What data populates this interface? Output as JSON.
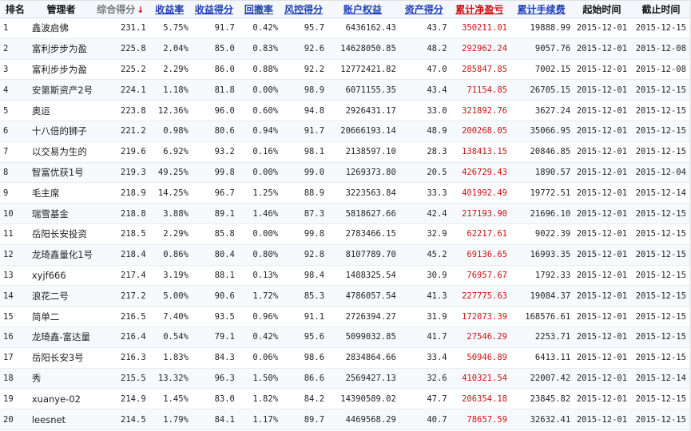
{
  "headers": {
    "rank": "排名",
    "manager": "管理者",
    "score": "综合得分",
    "score_arrow": "↓",
    "return_rate": "收益率",
    "return_score": "收益得分",
    "drawdown": "回撤率",
    "risk_score": "风控得分",
    "equity": "账户权益",
    "asset_score": "资产得分",
    "cum_pnl": "累计净盈亏",
    "cum_fee": "累计手续费",
    "start_date": "起始时间",
    "end_date": "截止时间"
  },
  "colors": {
    "link": "#1e3fb8",
    "pnl": "#cc1111",
    "header_bg": "#f4f7fb"
  },
  "rows": [
    {
      "rank": "1",
      "manager": "鑫波启佛",
      "score": "231.1",
      "return_rate": "5.75%",
      "return_score": "91.7",
      "drawdown": "0.42%",
      "risk_score": "95.7",
      "equity": "6436162.43",
      "asset_score": "43.7",
      "cum_pnl": "350211.01",
      "cum_fee": "19888.99",
      "start_date": "2015-12-01",
      "end_date": "2015-12-15"
    },
    {
      "rank": "2",
      "manager": "富利步步为盈",
      "score": "225.8",
      "return_rate": "2.04%",
      "return_score": "85.0",
      "drawdown": "0.83%",
      "risk_score": "92.6",
      "equity": "14628050.85",
      "asset_score": "48.2",
      "cum_pnl": "292962.24",
      "cum_fee": "9057.76",
      "start_date": "2015-12-01",
      "end_date": "2015-12-08"
    },
    {
      "rank": "3",
      "manager": "富利步步为盈",
      "score": "225.2",
      "return_rate": "2.29%",
      "return_score": "86.0",
      "drawdown": "0.88%",
      "risk_score": "92.2",
      "equity": "12772421.82",
      "asset_score": "47.0",
      "cum_pnl": "285847.85",
      "cum_fee": "7002.15",
      "start_date": "2015-12-01",
      "end_date": "2015-12-08"
    },
    {
      "rank": "4",
      "manager": "安第斯资产2号",
      "score": "224.1",
      "return_rate": "1.18%",
      "return_score": "81.8",
      "drawdown": "0.00%",
      "risk_score": "98.9",
      "equity": "6071155.35",
      "asset_score": "43.4",
      "cum_pnl": "71154.85",
      "cum_fee": "26705.15",
      "start_date": "2015-12-01",
      "end_date": "2015-12-15"
    },
    {
      "rank": "5",
      "manager": "奥运",
      "score": "223.8",
      "return_rate": "12.36%",
      "return_score": "96.0",
      "drawdown": "0.60%",
      "risk_score": "94.8",
      "equity": "2926431.17",
      "asset_score": "33.0",
      "cum_pnl": "321892.76",
      "cum_fee": "3627.24",
      "start_date": "2015-12-01",
      "end_date": "2015-12-15"
    },
    {
      "rank": "6",
      "manager": "十八倍的狮子",
      "score": "221.2",
      "return_rate": "0.98%",
      "return_score": "80.6",
      "drawdown": "0.94%",
      "risk_score": "91.7",
      "equity": "20666193.14",
      "asset_score": "48.9",
      "cum_pnl": "200268.05",
      "cum_fee": "35066.95",
      "start_date": "2015-12-01",
      "end_date": "2015-12-15"
    },
    {
      "rank": "7",
      "manager": "以交易为生的",
      "score": "219.6",
      "return_rate": "6.92%",
      "return_score": "93.2",
      "drawdown": "0.16%",
      "risk_score": "98.1",
      "equity": "2138597.10",
      "asset_score": "28.3",
      "cum_pnl": "138413.15",
      "cum_fee": "20846.85",
      "start_date": "2015-12-01",
      "end_date": "2015-12-15"
    },
    {
      "rank": "8",
      "manager": "智富优获1号",
      "score": "219.3",
      "return_rate": "49.25%",
      "return_score": "99.8",
      "drawdown": "0.00%",
      "risk_score": "99.0",
      "equity": "1269373.80",
      "asset_score": "20.5",
      "cum_pnl": "426729.43",
      "cum_fee": "1890.57",
      "start_date": "2015-12-01",
      "end_date": "2015-12-04"
    },
    {
      "rank": "9",
      "manager": "毛主席",
      "score": "218.9",
      "return_rate": "14.25%",
      "return_score": "96.7",
      "drawdown": "1.25%",
      "risk_score": "88.9",
      "equity": "3223563.84",
      "asset_score": "33.3",
      "cum_pnl": "401992.49",
      "cum_fee": "19772.51",
      "start_date": "2015-12-01",
      "end_date": "2015-12-14"
    },
    {
      "rank": "10",
      "manager": "瑞雪基金",
      "score": "218.8",
      "return_rate": "3.88%",
      "return_score": "89.1",
      "drawdown": "1.46%",
      "risk_score": "87.3",
      "equity": "5818627.66",
      "asset_score": "42.4",
      "cum_pnl": "217193.90",
      "cum_fee": "21696.10",
      "start_date": "2015-12-01",
      "end_date": "2015-12-15"
    },
    {
      "rank": "11",
      "manager": "岳阳长安投资",
      "score": "218.5",
      "return_rate": "2.29%",
      "return_score": "85.8",
      "drawdown": "0.00%",
      "risk_score": "99.8",
      "equity": "2783466.15",
      "asset_score": "32.9",
      "cum_pnl": "62217.61",
      "cum_fee": "9022.39",
      "start_date": "2015-12-01",
      "end_date": "2015-12-15"
    },
    {
      "rank": "12",
      "manager": "龙琦鑫量化1号",
      "score": "218.4",
      "return_rate": "0.86%",
      "return_score": "80.4",
      "drawdown": "0.80%",
      "risk_score": "92.8",
      "equity": "8107789.70",
      "asset_score": "45.2",
      "cum_pnl": "69136.65",
      "cum_fee": "16993.35",
      "start_date": "2015-12-01",
      "end_date": "2015-12-15"
    },
    {
      "rank": "13",
      "manager": "xyjf666",
      "score": "217.4",
      "return_rate": "3.19%",
      "return_score": "88.1",
      "drawdown": "0.13%",
      "risk_score": "98.4",
      "equity": "1488325.54",
      "asset_score": "30.9",
      "cum_pnl": "76957.67",
      "cum_fee": "1792.33",
      "start_date": "2015-12-01",
      "end_date": "2015-12-15"
    },
    {
      "rank": "14",
      "manager": "浪花二号",
      "score": "217.2",
      "return_rate": "5.00%",
      "return_score": "90.6",
      "drawdown": "1.72%",
      "risk_score": "85.3",
      "equity": "4786057.54",
      "asset_score": "41.3",
      "cum_pnl": "227775.63",
      "cum_fee": "19084.37",
      "start_date": "2015-12-01",
      "end_date": "2015-12-15"
    },
    {
      "rank": "15",
      "manager": "简单二",
      "score": "216.5",
      "return_rate": "7.40%",
      "return_score": "93.5",
      "drawdown": "0.96%",
      "risk_score": "91.1",
      "equity": "2726394.27",
      "asset_score": "31.9",
      "cum_pnl": "172073.39",
      "cum_fee": "168576.61",
      "start_date": "2015-12-01",
      "end_date": "2015-12-15"
    },
    {
      "rank": "16",
      "manager": "龙琦鑫-富达量",
      "score": "216.4",
      "return_rate": "0.54%",
      "return_score": "79.1",
      "drawdown": "0.42%",
      "risk_score": "95.6",
      "equity": "5099032.85",
      "asset_score": "41.7",
      "cum_pnl": "27546.29",
      "cum_fee": "2253.71",
      "start_date": "2015-12-01",
      "end_date": "2015-12-15"
    },
    {
      "rank": "17",
      "manager": "岳阳长安3号",
      "score": "216.3",
      "return_rate": "1.83%",
      "return_score": "84.3",
      "drawdown": "0.06%",
      "risk_score": "98.6",
      "equity": "2834864.66",
      "asset_score": "33.4",
      "cum_pnl": "50946.89",
      "cum_fee": "6413.11",
      "start_date": "2015-12-01",
      "end_date": "2015-12-15"
    },
    {
      "rank": "18",
      "manager": "秀",
      "score": "215.5",
      "return_rate": "13.32%",
      "return_score": "96.3",
      "drawdown": "1.50%",
      "risk_score": "86.6",
      "equity": "2569427.13",
      "asset_score": "32.6",
      "cum_pnl": "410321.54",
      "cum_fee": "22007.42",
      "start_date": "2015-12-01",
      "end_date": "2015-12-14"
    },
    {
      "rank": "19",
      "manager": "xuanye-02",
      "score": "214.9",
      "return_rate": "1.45%",
      "return_score": "83.0",
      "drawdown": "1.82%",
      "risk_score": "84.2",
      "equity": "14390589.02",
      "asset_score": "47.7",
      "cum_pnl": "206354.18",
      "cum_fee": "23845.82",
      "start_date": "2015-12-01",
      "end_date": "2015-12-15"
    },
    {
      "rank": "20",
      "manager": "leesnet",
      "score": "214.5",
      "return_rate": "1.79%",
      "return_score": "84.1",
      "drawdown": "1.17%",
      "risk_score": "89.7",
      "equity": "4469568.29",
      "asset_score": "40.7",
      "cum_pnl": "78657.59",
      "cum_fee": "32632.41",
      "start_date": "2015-12-01",
      "end_date": "2015-12-15"
    }
  ]
}
